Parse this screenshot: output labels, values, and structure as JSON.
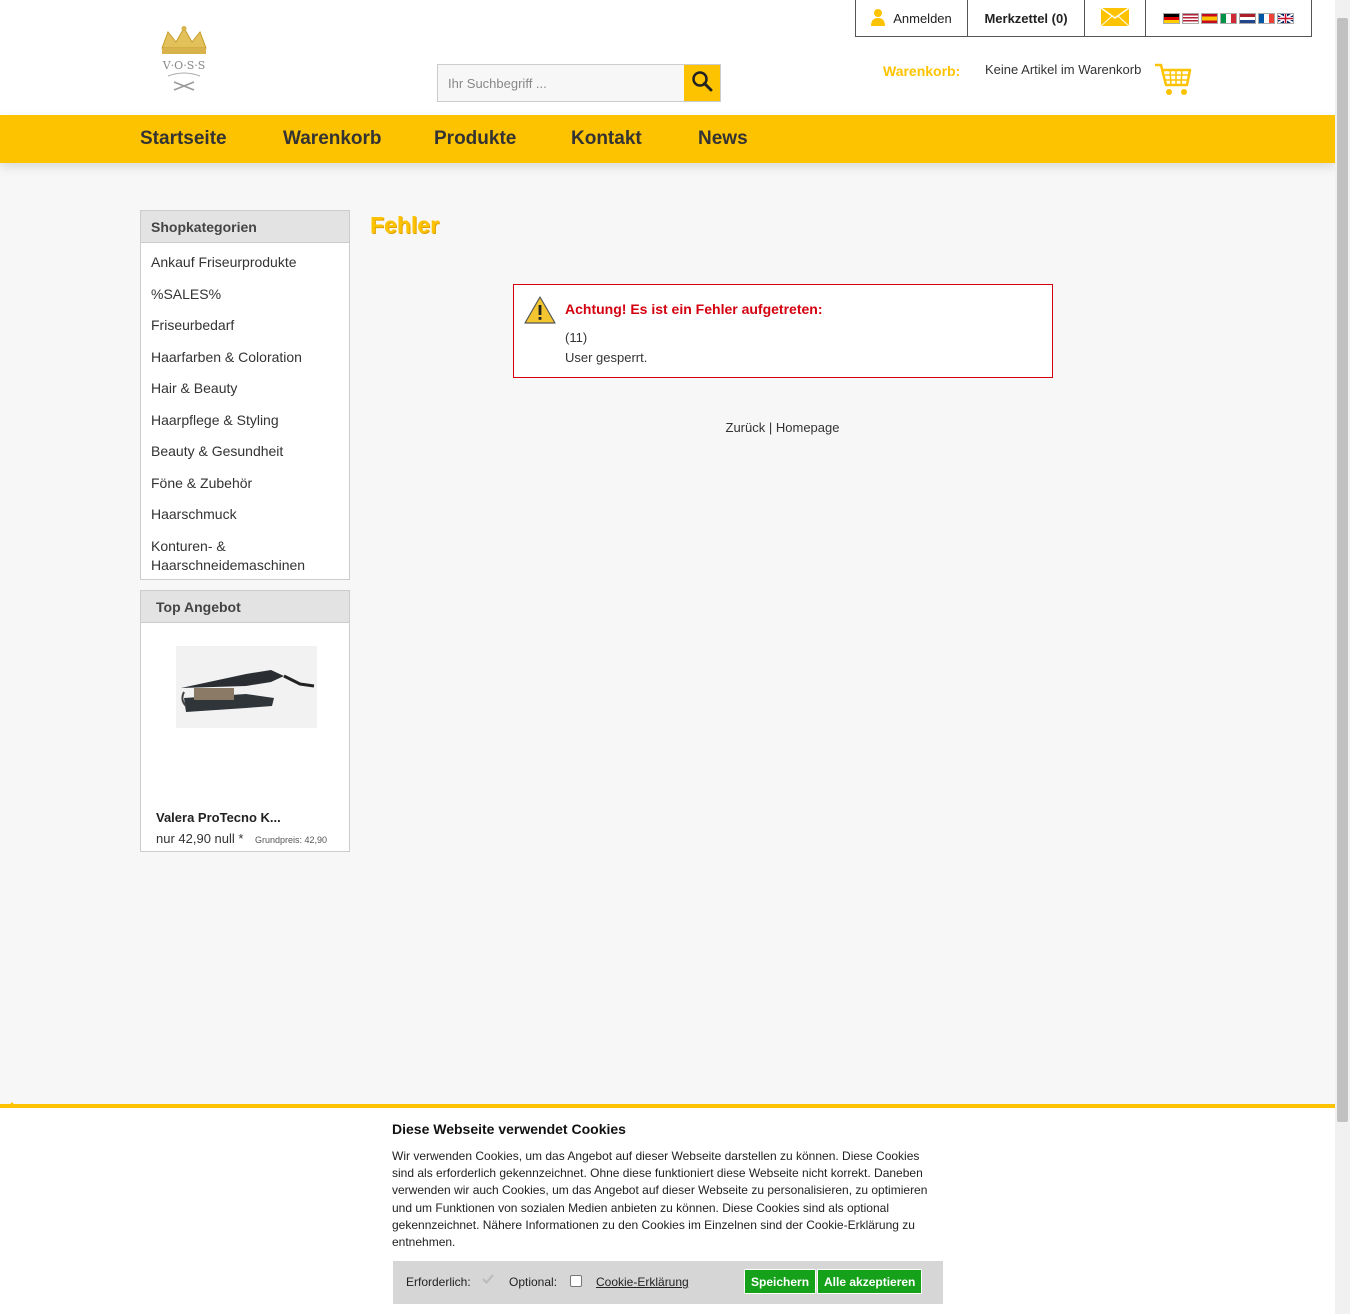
{
  "header": {
    "login_label": "Anmelden",
    "wishlist_label": "Merkzettel (0)",
    "search_placeholder": "Ihr Suchbegriff ...",
    "cart_label": "Warenkorb:",
    "cart_status": "Keine Artikel im Warenkorb",
    "flags": [
      "de",
      "us",
      "es",
      "it",
      "nl",
      "fr",
      "gb"
    ]
  },
  "nav": {
    "items": [
      "Startseite",
      "Warenkorb",
      "Produkte",
      "Kontakt",
      "News"
    ]
  },
  "sidebar": {
    "categories_title": "Shopkategorien",
    "categories": [
      "Ankauf Friseurprodukte",
      "%SALES%",
      "Friseurbedarf",
      "Haarfarben & Coloration",
      "Hair & Beauty",
      "Haarpflege & Styling",
      "Beauty & Gesundheit",
      "Föne & Zubehör",
      "Haarschmuck",
      "Konturen- & Haarschneidemaschinen"
    ],
    "top_offer": {
      "title": "Top Angebot",
      "product_name": "Valera ProTecno K...",
      "price": "nur 42,90 null *",
      "base_price": "Grundpreis: 42,90"
    }
  },
  "main": {
    "title": "Fehler",
    "error_title": "Achtung! Es ist ein Fehler aufgetreten:",
    "error_code": "(11)",
    "error_message": "User gesperrt.",
    "back_link": "Zurück",
    "separator": "|",
    "home_link": "Homepage"
  },
  "cookie": {
    "title": "Diese Webseite verwendet Cookies",
    "text": "Wir verwenden Cookies, um das Angebot auf dieser Webseite darstellen zu können. Diese Cookies sind als erforderlich gekennzeichnet. Ohne diese funktioniert diese Webseite nicht korrekt. Daneben verwenden wir auch Cookies, um das Angebot auf dieser Webseite zu personalisieren, zu optimieren und um Funktionen von sozialen Medien anbieten zu können. Diese Cookies sind als optional gekennzeichnet. Nähere Informationen zu den Cookies im Einzelnen sind der Cookie-Erklärung zu entnehmen.",
    "required_label": "Erforderlich:",
    "optional_label": "Optional:",
    "policy_link": "Cookie-Erklärung",
    "save_button": "Speichern",
    "accept_all_button": "Alle akzeptieren"
  },
  "colors": {
    "accent": "#fec300",
    "error": "#d4000f",
    "button_green": "#16a11b"
  }
}
